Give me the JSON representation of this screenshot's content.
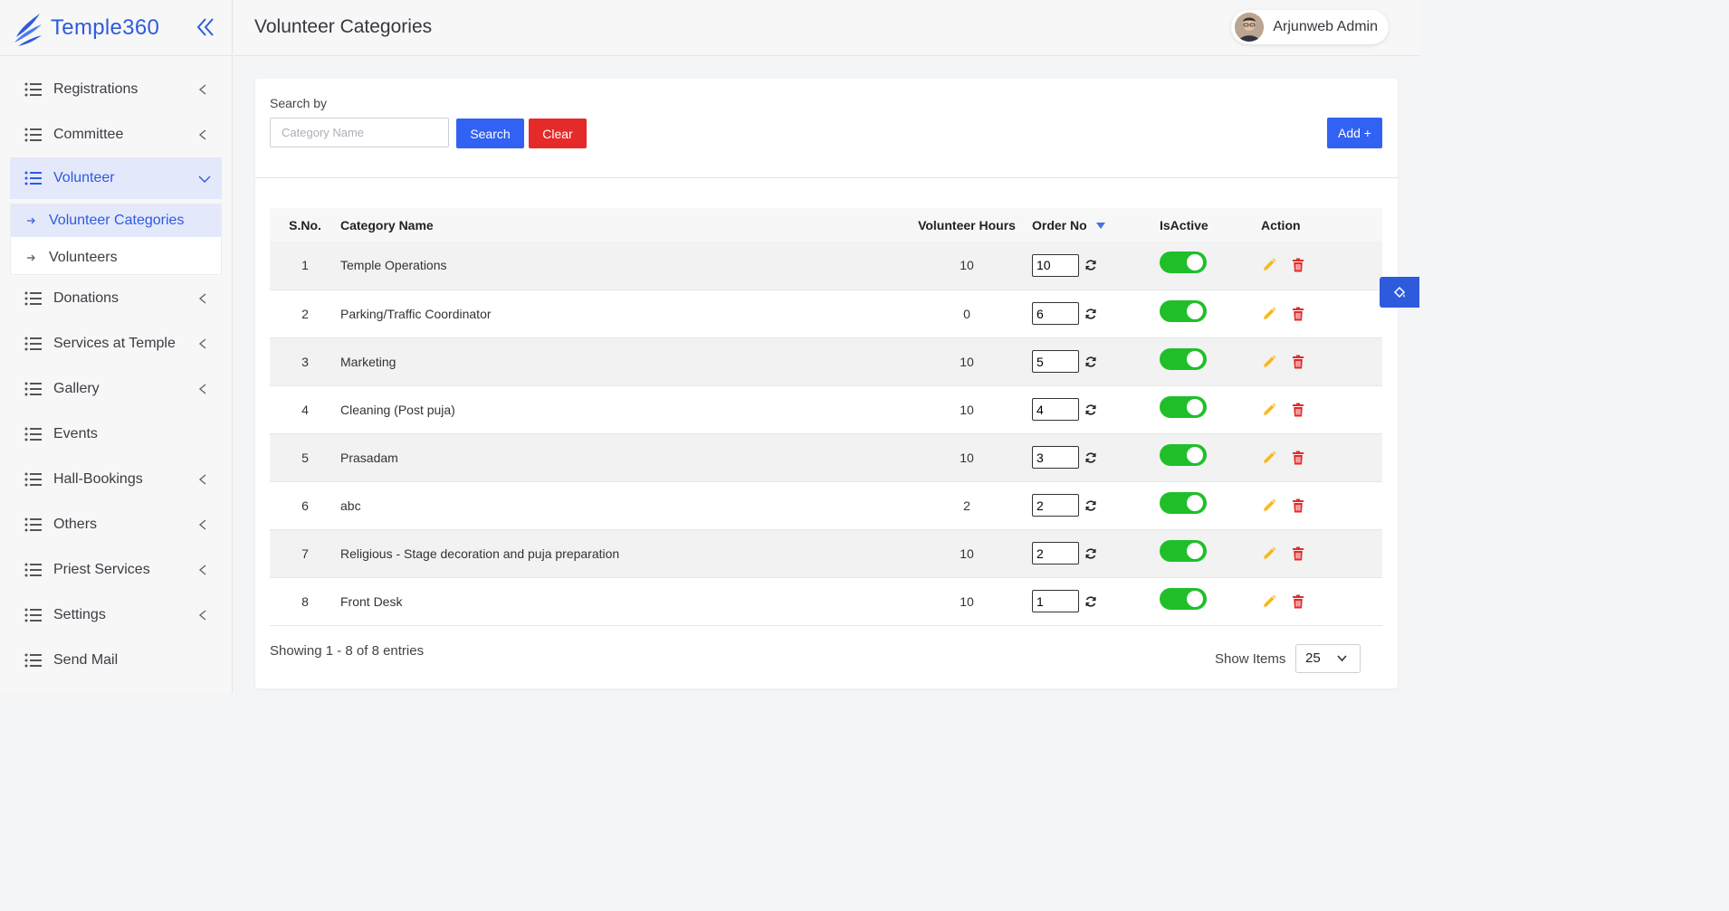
{
  "brand": {
    "name": "Temple360"
  },
  "sidebar": {
    "items": [
      {
        "label": "Registrations",
        "has_chevron": true
      },
      {
        "label": "Committee",
        "has_chevron": true
      },
      {
        "label": "Volunteer",
        "has_chevron": true,
        "expanded": true
      },
      {
        "label": "Donations",
        "has_chevron": true
      },
      {
        "label": "Services at Temple",
        "has_chevron": true
      },
      {
        "label": "Gallery",
        "has_chevron": true
      },
      {
        "label": "Events",
        "has_chevron": false
      },
      {
        "label": "Hall-Bookings",
        "has_chevron": true
      },
      {
        "label": "Others",
        "has_chevron": true
      },
      {
        "label": "Priest Services",
        "has_chevron": true
      },
      {
        "label": "Settings",
        "has_chevron": true
      },
      {
        "label": "Send Mail",
        "has_chevron": false
      }
    ],
    "volunteer_sub": [
      {
        "label": "Volunteer Categories",
        "active": true
      },
      {
        "label": "Volunteers",
        "active": false
      }
    ]
  },
  "header": {
    "title": "Volunteer Categories",
    "user_name": "Arjunweb Admin"
  },
  "search": {
    "label": "Search by",
    "placeholder": "Category Name",
    "search_label": "Search",
    "clear_label": "Clear",
    "add_label": "Add +"
  },
  "table": {
    "columns": [
      "S.No.",
      "Category Name",
      "Volunteer Hours",
      "Order No",
      "IsActive",
      "Action"
    ],
    "rows": [
      {
        "sno": "1",
        "name": "Temple Operations",
        "hours": "10",
        "order": "10",
        "active": true
      },
      {
        "sno": "2",
        "name": "Parking/Traffic Coordinator",
        "hours": "0",
        "order": "6",
        "active": true
      },
      {
        "sno": "3",
        "name": "Marketing",
        "hours": "10",
        "order": "5",
        "active": true
      },
      {
        "sno": "4",
        "name": "Cleaning (Post puja)",
        "hours": "10",
        "order": "4",
        "active": true
      },
      {
        "sno": "5",
        "name": "Prasadam",
        "hours": "10",
        "order": "3",
        "active": true
      },
      {
        "sno": "6",
        "name": "abc",
        "hours": "2",
        "order": "2",
        "active": true
      },
      {
        "sno": "7",
        "name": "Religious - Stage decoration and puja preparation",
        "hours": "10",
        "order": "2",
        "active": true
      },
      {
        "sno": "8",
        "name": "Front Desk",
        "hours": "10",
        "order": "1",
        "active": true
      }
    ]
  },
  "footer": {
    "showing": "Showing 1 - 8 of 8 entries",
    "show_items_label": "Show Items",
    "page_size": "25"
  },
  "colors": {
    "primary": "#3262f4",
    "danger": "#e52a2a",
    "toggle_on": "#1fbf2a",
    "edit_icon": "#f6b91f",
    "delete_icon": "#e52a2a",
    "active_nav_bg": "#e3e8fb"
  }
}
